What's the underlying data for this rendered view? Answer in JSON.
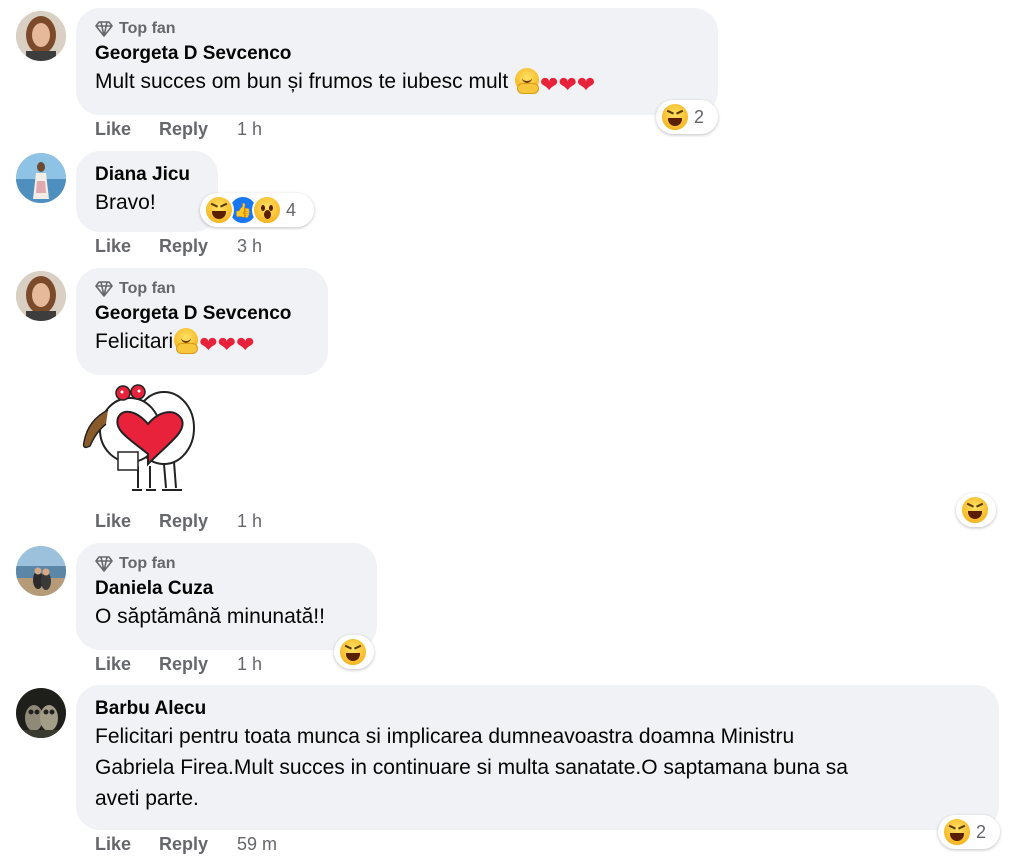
{
  "actions": {
    "like": "Like",
    "reply": "Reply"
  },
  "colors": {
    "bubble": "#f0f2f5",
    "meta": "#65676b",
    "heart": "#e8223a",
    "like_blue": "#1877f2"
  },
  "comments": [
    {
      "badge": "Top fan",
      "author": "Georgeta D Sevcenco",
      "text": "Mult succes om bun și frumos te iubesc mult",
      "emojis": [
        "hugging-face",
        "red-heart",
        "red-heart",
        "red-heart"
      ],
      "time": "1 h",
      "reactions": {
        "types": [
          "haha"
        ],
        "count": "2"
      }
    },
    {
      "author": "Diana Jicu",
      "text": "Bravo!",
      "time": "3 h",
      "reactions": {
        "types": [
          "haha",
          "like",
          "wow"
        ],
        "count": "4"
      }
    },
    {
      "badge": "Top fan",
      "author": "Georgeta D Sevcenco",
      "text": "Felicitari",
      "emojis": [
        "hugging-face",
        "red-heart",
        "red-heart",
        "red-heart"
      ],
      "sticker": "heart-hug-sticker",
      "time": "1 h",
      "reactions": {
        "types": [
          "haha"
        ],
        "count": ""
      }
    },
    {
      "badge": "Top fan",
      "author": "Daniela Cuza",
      "text": "O săptămână minunată!!",
      "time": "1 h",
      "reactions": {
        "types": [
          "haha"
        ],
        "count": ""
      }
    },
    {
      "author": "Barbu Alecu",
      "text_lines": [
        "Felicitari pentru toata munca si implicarea dumneavoastra doamna Ministru",
        "Gabriela Firea.Mult succes in continuare si multa sanatate.O saptamana buna sa",
        "aveti parte."
      ],
      "time": "59 m",
      "reactions": {
        "types": [
          "haha"
        ],
        "count": "2"
      }
    }
  ]
}
